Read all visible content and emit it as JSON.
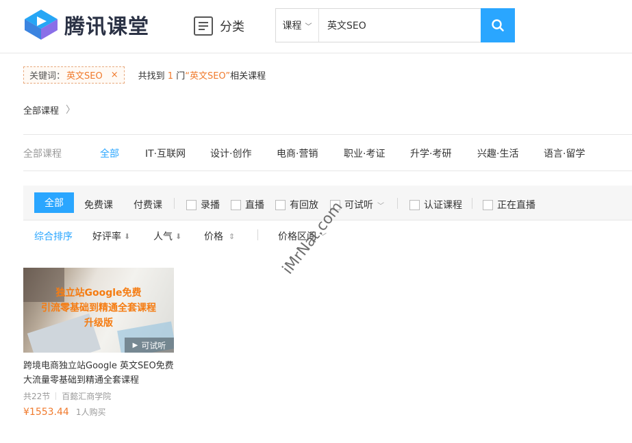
{
  "header": {
    "logo_text": "腾讯课堂",
    "category_label": "分类",
    "search": {
      "type_label": "课程",
      "value": "英文SEO"
    }
  },
  "keyword_row": {
    "label": "关键词：",
    "keyword": "英文SEO",
    "close": "×",
    "result_prefix": "共找到",
    "result_count": "1",
    "result_unit": "门",
    "result_keyword": "“英文SEO”",
    "result_suffix": "相关课程"
  },
  "breadcrumb": {
    "label": "全部课程",
    "arrow": "〉"
  },
  "category_nav": {
    "label": "全部课程",
    "items": [
      "全部",
      "IT·互联网",
      "设计·创作",
      "电商·营销",
      "职业·考证",
      "升学·考研",
      "兴趣·生活",
      "语言·留学"
    ]
  },
  "filters": {
    "price_tabs": [
      "全部",
      "免费课",
      "付费课"
    ],
    "checkboxes": [
      "录播",
      "直播",
      "有回放",
      "可试听",
      "认证课程",
      "正在直播"
    ],
    "sorts": [
      "综合排序",
      "好评率",
      "人气",
      "价格",
      "价格区间"
    ]
  },
  "courses": [
    {
      "thumb_lines": [
        "独立站Google免费",
        "引流零基础到精通全套课程",
        "升级版"
      ],
      "trial_label": "可试听",
      "title": "跨境电商独立站Google 英文SEO免费大流量零基础到精通全套课程",
      "lessons": "共22节",
      "org": "百懿汇商学院",
      "price": "¥1553.44",
      "buyers": "1人购买"
    }
  ],
  "watermark": "iMrNat.com",
  "colors": {
    "accent": "#2aa6ff",
    "highlight": "#f07a2c"
  }
}
